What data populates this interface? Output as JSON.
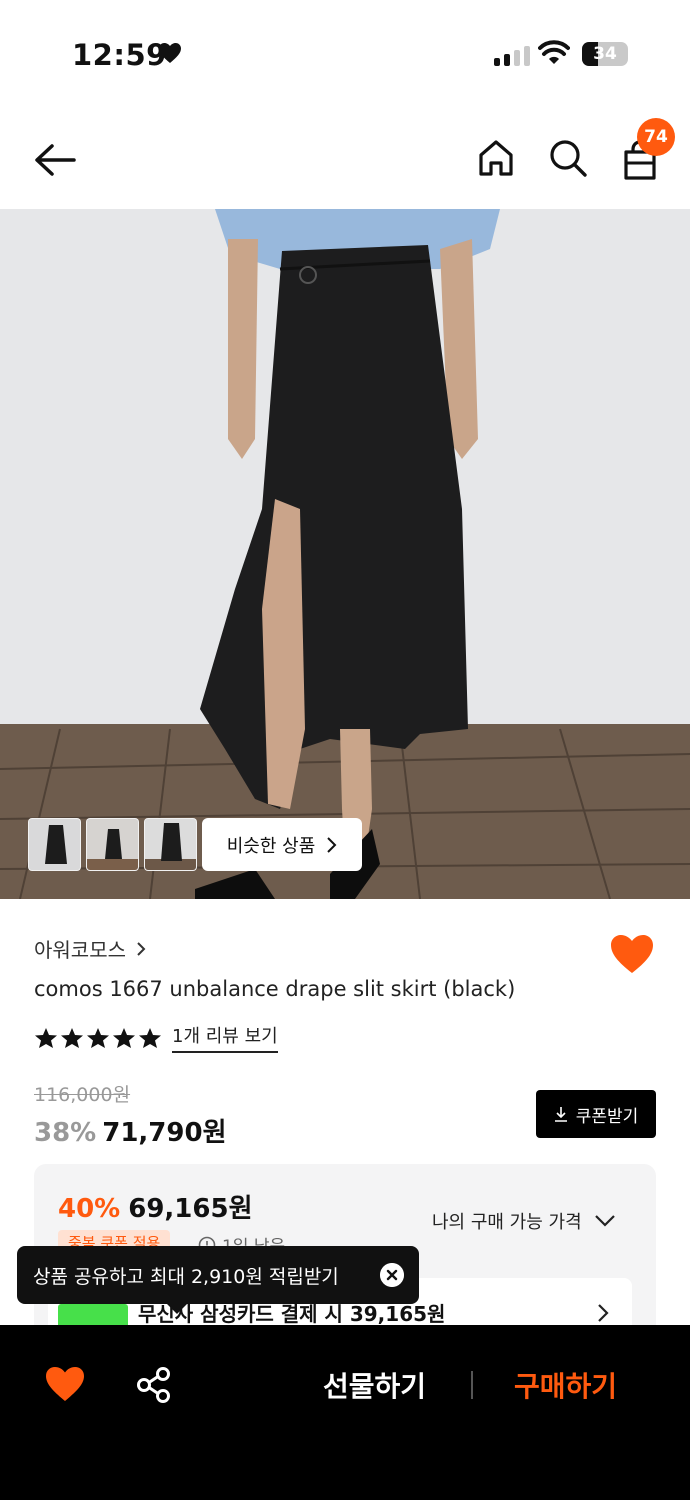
{
  "status_bar": {
    "time": "12:59",
    "battery": "34"
  },
  "header": {
    "cart_count": "74"
  },
  "similar_button": {
    "label": "비슷한 상품"
  },
  "product": {
    "brand": "아워코모스",
    "title": "comos 1667 unbalance drape slit skirt (black)",
    "rating_stars": 5,
    "review_link": "1개 리뷰 보기",
    "original_price": "116,000원",
    "discount_rate": "38%",
    "sale_price": "71,790원",
    "coupon_button": "쿠폰받기"
  },
  "best_price_panel": {
    "discount_rate": "40%",
    "price": "69,165원",
    "my_price_label": "나의 구매 가능 가격",
    "chip": "중복 쿠폰 적용",
    "remaining": "1일 남음",
    "card_offer": "무신사 삼성카드 결제 시 39,165원"
  },
  "toast": {
    "message": "상품 공유하고 최대 2,910원 적립받기"
  },
  "bottom_bar": {
    "gift_label": "선물하기",
    "buy_label": "구매하기"
  },
  "colors": {
    "accent": "#ff5a0f",
    "dark": "#000000"
  }
}
